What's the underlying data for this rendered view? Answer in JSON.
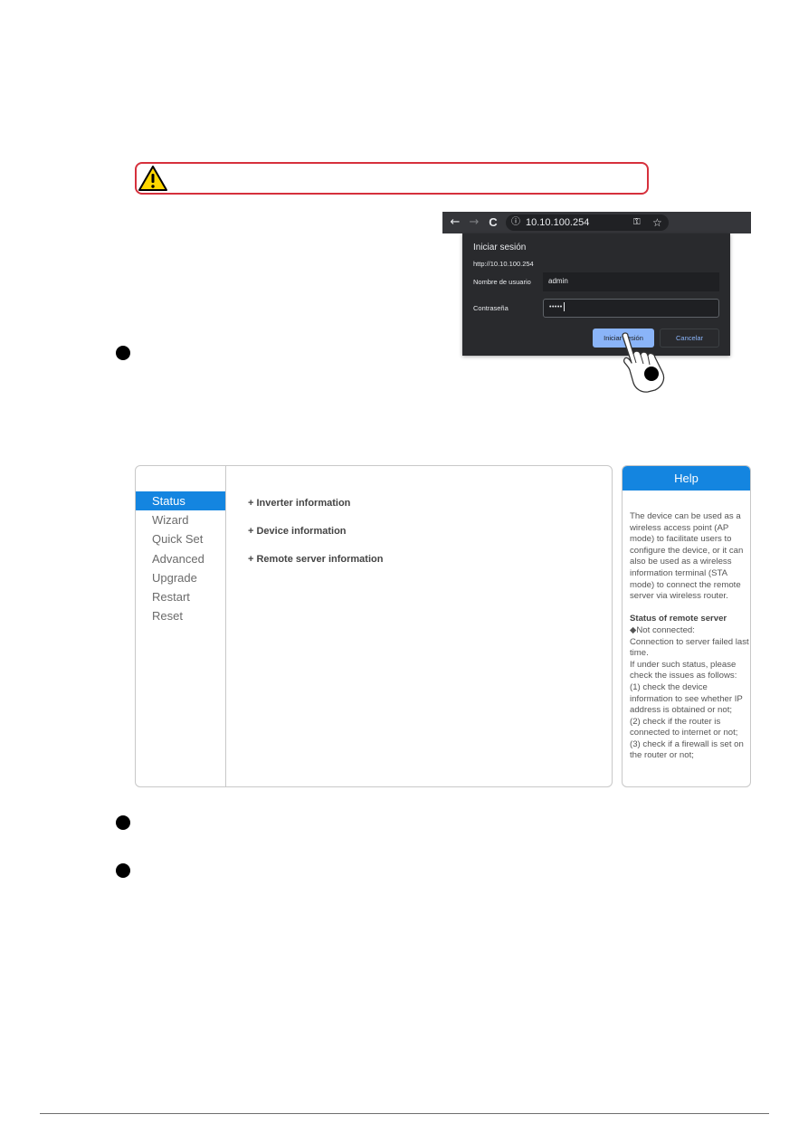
{
  "browser": {
    "back_icon": "arrow-left-icon",
    "forward_icon": "arrow-right-icon",
    "reload_icon": "reload-icon",
    "info_icon": "info-icon",
    "key_icon": "key-icon",
    "star_icon": "star-icon",
    "url": "10.10.100.254",
    "glyphs": {
      "back": "←",
      "forward": "→",
      "reload": "C",
      "info": "ⓘ",
      "key": "⚿",
      "star": "☆"
    }
  },
  "login_dialog": {
    "title": "Iniciar sesión",
    "url": "http://10.10.100.254",
    "username_label": "Nombre de usuario",
    "username_value": "admin",
    "password_label": "Contraseña",
    "password_value": "•••••",
    "submit_label": "Iniciar sesión",
    "cancel_label": "Cancelar"
  },
  "web_ui": {
    "menu": [
      {
        "label": "Status",
        "active": true
      },
      {
        "label": "Wizard",
        "active": false
      },
      {
        "label": "Quick Set",
        "active": false
      },
      {
        "label": "Advanced",
        "active": false
      },
      {
        "label": "Upgrade",
        "active": false
      },
      {
        "label": "Restart",
        "active": false
      },
      {
        "label": "Reset",
        "active": false
      }
    ],
    "sections": [
      {
        "label": "+ Inverter information"
      },
      {
        "label": "+ Device information"
      },
      {
        "label": "+ Remote server information"
      }
    ],
    "help": {
      "title": "Help",
      "intro": "The device can be used as a wireless access point (AP mode) to facilitate users to configure the device, or it can also be used as a wireless information terminal (STA mode) to connect the remote server via wireless router.",
      "status_heading": "Status of remote server",
      "lines": [
        "◆Not connected:",
        "Connection to server failed last time.",
        "If under such status, please check the issues as follows:",
        "(1) check the device information to see whether IP address is obtained or not;",
        "(2) check if the router is connected to internet or not;",
        "(3) check if a firewall is set on the router or not;"
      ]
    }
  },
  "colors": {
    "accent_blue": "#1485e0",
    "warning_border": "#d6303c",
    "warning_yellow": "#ffd600",
    "dialog_bg": "#292a2d",
    "dialog_button": "#8ab4f8"
  }
}
